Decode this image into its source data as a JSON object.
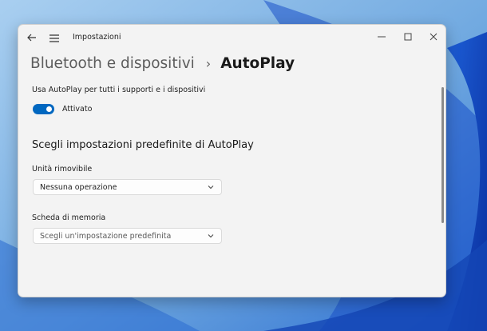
{
  "window": {
    "app_title": "Impostazioni",
    "controls": {
      "minimize_icon": "minimize-icon",
      "maximize_icon": "maximize-icon",
      "close_icon": "close-icon"
    }
  },
  "breadcrumb": {
    "parent": "Bluetooth e dispositivi",
    "separator": "›",
    "current": "AutoPlay"
  },
  "autoplay": {
    "label": "Usa AutoPlay per tutti i supporti e i dispositivi",
    "toggle_on": true,
    "toggle_state": "Attivato"
  },
  "defaults": {
    "title": "Scegli impostazioni predefinite di AutoPlay",
    "removable_drive": {
      "label": "Unità rimovibile",
      "value": "Nessuna operazione"
    },
    "memory_card": {
      "label": "Scheda di memoria",
      "placeholder": "Scegli un'impostazione predefinita"
    }
  },
  "colors": {
    "accent": "#0067c0",
    "window_bg": "#f3f3f3",
    "wallpaper": "#7fb6e8"
  }
}
